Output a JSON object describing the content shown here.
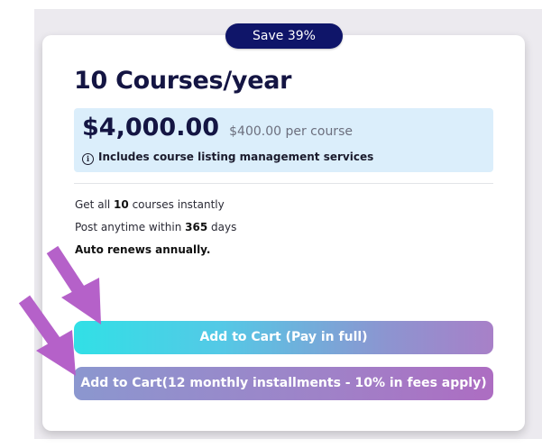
{
  "offer": {
    "badge": "Save 39%",
    "title": "10 Courses/year",
    "price": "$4,000.00",
    "price_per": "$400.00 per course",
    "info": "Includes course listing management services"
  },
  "features": {
    "f1_pre": "Get all ",
    "f1_bold": "10",
    "f1_post": " courses instantly",
    "f2_pre": "Post anytime within ",
    "f2_bold": "365",
    "f2_post": " days",
    "f3": "Auto renews annually."
  },
  "buttons": {
    "full": "Add to Cart (Pay in full)",
    "install": "Add to Cart(12 monthly installments - 10% in fees apply)"
  },
  "annotations": {
    "arrow_color": "#b561c9"
  },
  "colors": {
    "badge_bg": "#0f1569",
    "price_box_bg": "#dbeefb"
  }
}
